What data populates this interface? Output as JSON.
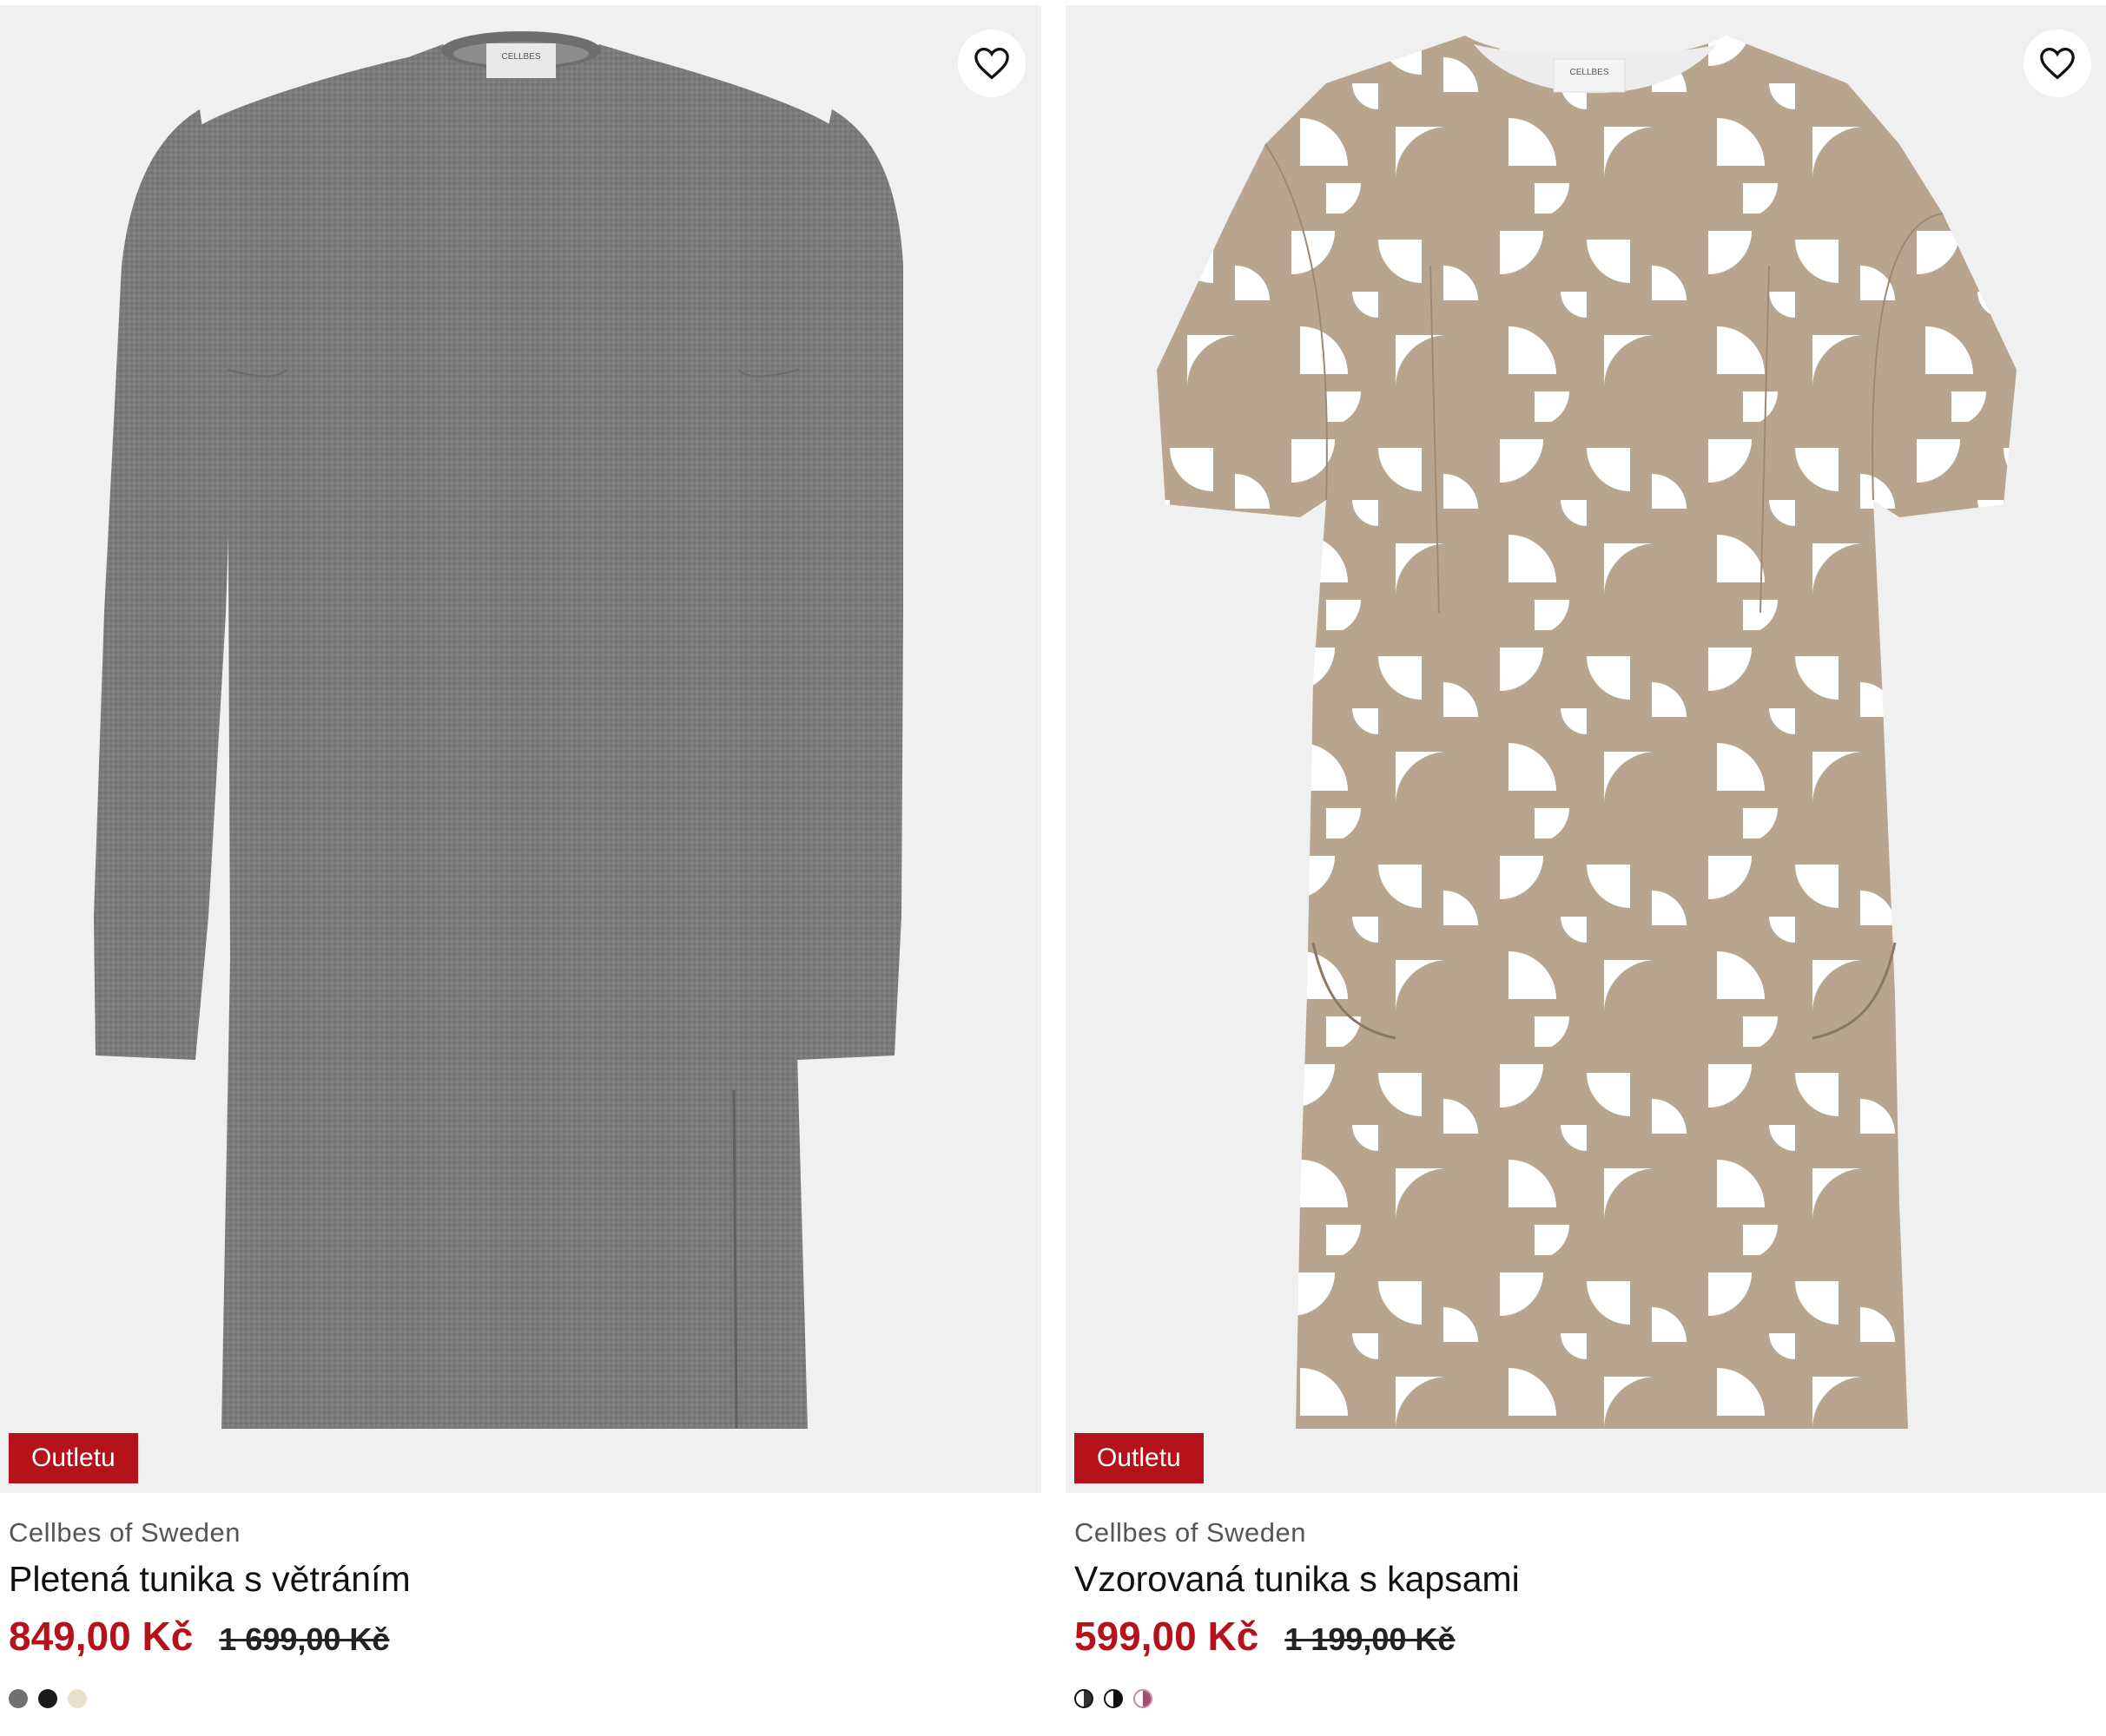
{
  "products": [
    {
      "badge": "Outletu",
      "brand": "Cellbes of Sweden",
      "title": "Pletená tunika s větráním",
      "price_sale": "849,00 Kč",
      "price_original": "1 699,00 Kč",
      "image_label": "CELLBES",
      "swatches": [
        "#707070",
        "#1a1a1a",
        "#e8dfcc"
      ]
    },
    {
      "badge": "Outletu",
      "brand": "Cellbes of Sweden",
      "title": "Vzorovaná tunika s kapsami",
      "price_sale": "599,00 Kč",
      "price_original": "1 199,00 Kč",
      "image_label": "CELLBES",
      "swatches": [
        "#ffffff/#333333",
        "#ffffff/#111111",
        "#ffffff/#a0506e"
      ]
    }
  ],
  "colors": {
    "accent_red": "#b5121b",
    "image_bg": "#f0f0f0",
    "knit_grey": "#7a7a7a",
    "print_beige": "#b8a590"
  },
  "icons": {
    "favorite": "heart-outline-icon"
  }
}
